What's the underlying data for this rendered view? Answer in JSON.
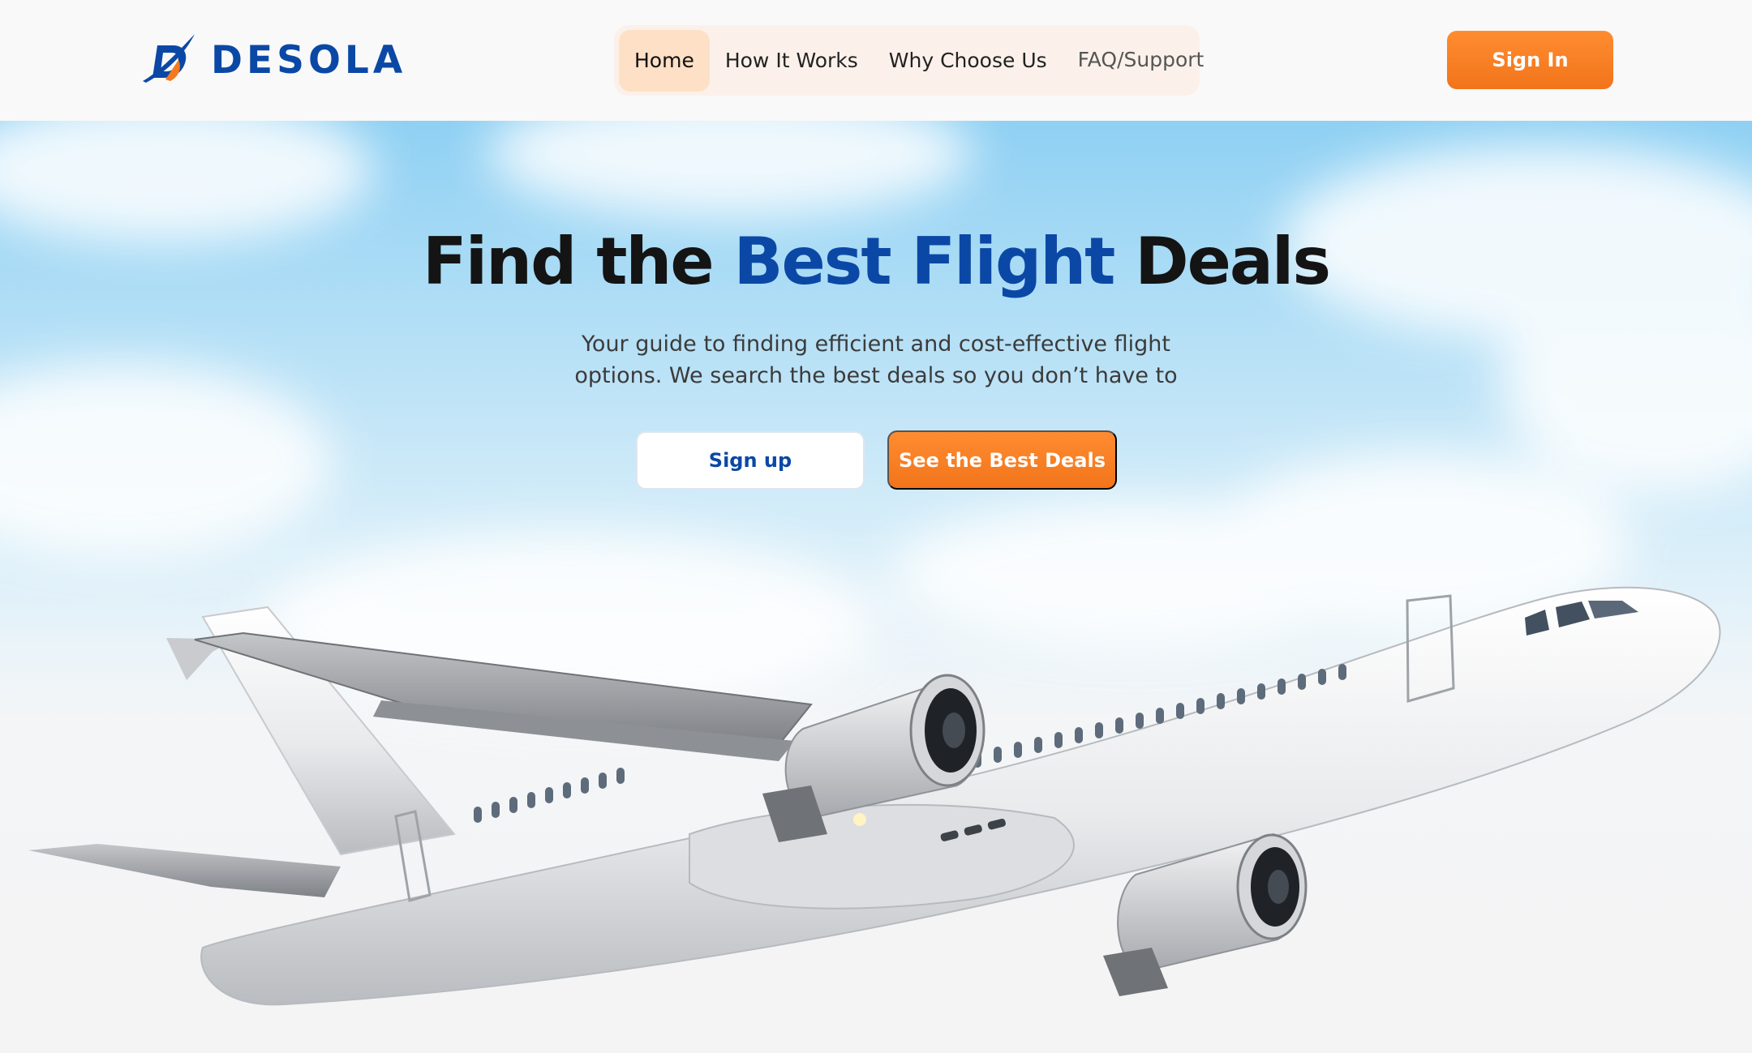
{
  "brand": {
    "name": "DESOLA",
    "primary_color": "#0b48a6",
    "accent_color": "#f47a1f",
    "logo_icon": "plane-swoosh-logo-icon"
  },
  "nav": {
    "items": [
      {
        "label": "Home",
        "active": true
      },
      {
        "label": "How It Works",
        "active": false
      },
      {
        "label": "Why Choose Us",
        "active": false
      },
      {
        "label": "FAQ/Support",
        "active": false
      }
    ]
  },
  "header": {
    "signin_label": "Sign In"
  },
  "hero": {
    "title_start": "Find the ",
    "title_accent": "Best Flight",
    "title_end": " Deals",
    "subtitle_line1": "Your guide to finding efficient and cost-effective flight",
    "subtitle_line2": "options. We search the best deals so you don’t have to",
    "signup_label": "Sign up",
    "deals_label": "See the Best Deals",
    "image": "white-airplane-taking-off"
  }
}
